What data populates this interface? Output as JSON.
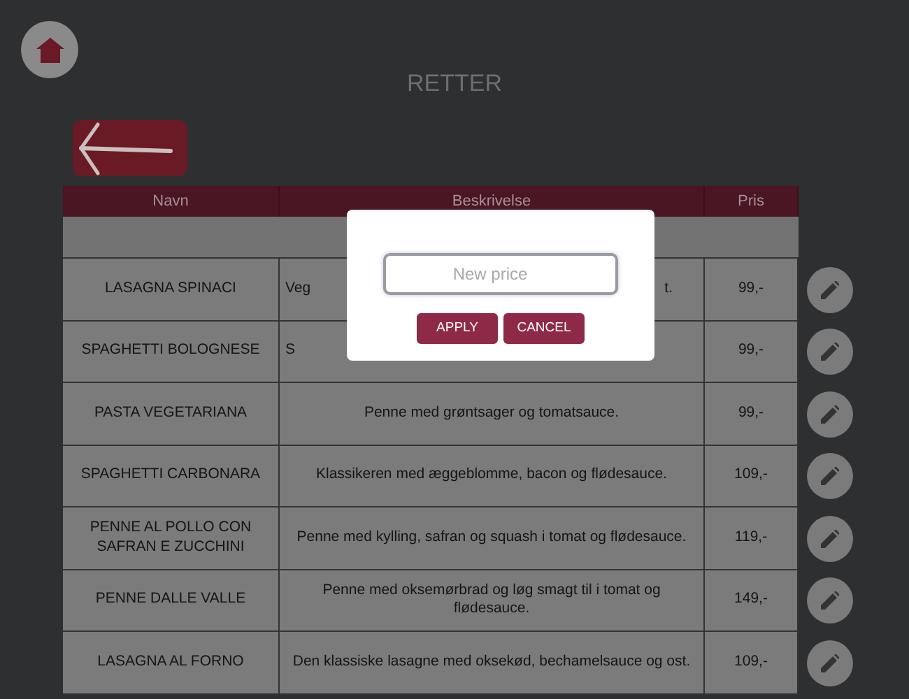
{
  "page": {
    "title": "RETTER"
  },
  "table": {
    "columns": [
      "Navn",
      "Beskrivelse",
      "Pris"
    ],
    "rows": [
      {
        "name": "LASAGNA SPINACI",
        "description": "Veg",
        "description_end": "t.",
        "price": "99,-"
      },
      {
        "name": "SPAGHETTI BOLOGNESE",
        "description": "S",
        "price": "99,-"
      },
      {
        "name": "PASTA VEGETARIANA",
        "description": "Penne med grøntsager og tomatsauce.",
        "price": "99,-"
      },
      {
        "name": "SPAGHETTI CARBONARA",
        "description": "Klassikeren med æggeblomme, bacon og flødesauce.",
        "price": "109,-"
      },
      {
        "name": "PENNE AL POLLO CON SAFRAN E ZUCCHINI",
        "description": "Penne med kylling, safran og squash i tomat og flødesauce.",
        "price": "119,-"
      },
      {
        "name": "PENNE DALLE VALLE",
        "description": "Penne med oksemørbrad og løg smagt til i tomat og flødesauce.",
        "price": "149,-"
      },
      {
        "name": "LASAGNA AL FORNO",
        "description": "Den klassiske lasagne med oksekød, bechamelsauce og ost.",
        "price": "109,-"
      }
    ]
  },
  "dialog": {
    "input": {
      "placeholder": "New price"
    },
    "buttons": [
      "APPLY",
      "CANCEL"
    ]
  }
}
